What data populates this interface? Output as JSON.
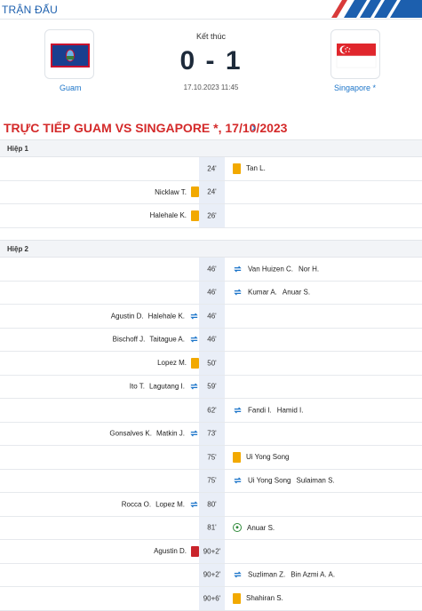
{
  "header": {
    "title": "TRẬN ĐẤU"
  },
  "match": {
    "status": "Kết thúc",
    "score": "0 - 1",
    "datetime": "17.10.2023 11:45",
    "home": {
      "name": "Guam"
    },
    "away": {
      "name": "Singapore *"
    }
  },
  "live": {
    "title": "TRỰC TIẾP GUAM VS SINGAPORE *, 17/10/2023"
  },
  "colors": {
    "accent": "#1c75c9",
    "live_red": "#d42a2a",
    "yellow_card": "#f2a900",
    "red_card": "#c9242b",
    "minute_bg": "#e9eef7"
  },
  "periods": [
    {
      "label": "Hiệp 1",
      "events": [
        {
          "minute": "24'",
          "side": "away",
          "type": "yellow-card",
          "player": "Tan L.",
          "player2": ""
        },
        {
          "minute": "24'",
          "side": "home",
          "type": "yellow-card",
          "player": "Nicklaw T.",
          "player2": ""
        },
        {
          "minute": "26'",
          "side": "home",
          "type": "yellow-card",
          "player": "Halehale K.",
          "player2": ""
        }
      ]
    },
    {
      "label": "Hiệp 2",
      "events": [
        {
          "minute": "46'",
          "side": "away",
          "type": "substitution",
          "player": "Van Huizen C.",
          "player2": "Nor H."
        },
        {
          "minute": "46'",
          "side": "away",
          "type": "substitution",
          "player": "Kumar A.",
          "player2": "Anuar S."
        },
        {
          "minute": "46'",
          "side": "home",
          "type": "substitution",
          "player": "Halehale K.",
          "player2": "Agustin D."
        },
        {
          "minute": "46'",
          "side": "home",
          "type": "substitution",
          "player": "Taitague A.",
          "player2": "Bischoff J."
        },
        {
          "minute": "50'",
          "side": "home",
          "type": "yellow-card",
          "player": "Lopez M.",
          "player2": ""
        },
        {
          "minute": "59'",
          "side": "home",
          "type": "substitution",
          "player": "Lagutang I.",
          "player2": "Ito T."
        },
        {
          "minute": "62'",
          "side": "away",
          "type": "substitution",
          "player": "Fandi I.",
          "player2": "Hamid I."
        },
        {
          "minute": "73'",
          "side": "home",
          "type": "substitution",
          "player": "Matkin J.",
          "player2": "Gonsalves K."
        },
        {
          "minute": "75'",
          "side": "away",
          "type": "yellow-card",
          "player": "Ui Yong Song",
          "player2": ""
        },
        {
          "minute": "75'",
          "side": "away",
          "type": "substitution",
          "player": "Ui Yong Song",
          "player2": "Sulaiman S."
        },
        {
          "minute": "80'",
          "side": "home",
          "type": "substitution",
          "player": "Lopez M.",
          "player2": "Rocca O."
        },
        {
          "minute": "81'",
          "side": "away",
          "type": "goal",
          "player": "Anuar S.",
          "player2": ""
        },
        {
          "minute": "90+2'",
          "side": "home",
          "type": "red-card",
          "player": "Agustin D.",
          "player2": ""
        },
        {
          "minute": "90+2'",
          "side": "away",
          "type": "substitution",
          "player": "Suzliman Z.",
          "player2": "Bin Azmi A. A."
        },
        {
          "minute": "90+6'",
          "side": "away",
          "type": "yellow-card",
          "player": "Shahiran S.",
          "player2": ""
        }
      ]
    }
  ]
}
